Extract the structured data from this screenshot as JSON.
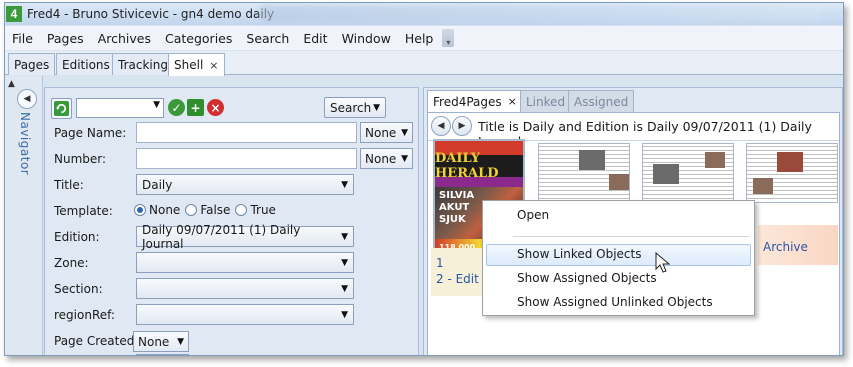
{
  "window": {
    "app_icon_glyph": "4",
    "title": "Fred4 - Bruno Stivicevic - gn4 demo daily"
  },
  "menu": [
    "File",
    "Pages",
    "Archives",
    "Categories",
    "Search",
    "Edit",
    "Window",
    "Help"
  ],
  "main_tabs": [
    {
      "label": "Pages"
    },
    {
      "label": "Editions"
    },
    {
      "label": "Tracking"
    },
    {
      "label": "Shell",
      "active": true,
      "close": "×"
    }
  ],
  "navigator": {
    "label": "Navigator"
  },
  "search_panel": {
    "search_button": "Search",
    "fields": {
      "page_name": "Page Name:",
      "number": "Number:",
      "title": "Title:",
      "template": "Template:",
      "edition": "Edition:",
      "zone": "Zone:",
      "section": "Section:",
      "region_ref": "regionRef:",
      "page_created": "Page Created:"
    },
    "none_option": "None",
    "title_value": "Daily",
    "template_options": [
      {
        "label": "None",
        "selected": true
      },
      {
        "label": "False",
        "selected": false
      },
      {
        "label": "True",
        "selected": false
      }
    ],
    "edition_value": "Daily 09/07/2011 (1) Daily Journal",
    "page_created_value": "None"
  },
  "right_panel": {
    "tabs": [
      {
        "label": "Fred4Pages",
        "active": true,
        "close": "×"
      },
      {
        "label": "Linked",
        "active": false
      },
      {
        "label": "Assigned",
        "active": false
      }
    ],
    "filter_text": "Title is Daily and Edition is Daily 09/07/2011 (1) Daily Journal",
    "thumbnail": {
      "masthead": "DAILY HERALD",
      "headline_lines": [
        "SILVIA",
        "AKUT",
        "SJUK"
      ],
      "footer_number": "118 000"
    },
    "list_items": [
      "1",
      "2 - Edit"
    ],
    "archive_label": "Archive"
  },
  "context_menu": {
    "items": [
      "Open",
      "Show Linked Objects",
      "Show Assigned Objects",
      "Show Assigned Unlinked Objects"
    ],
    "hovered_index": 1
  }
}
